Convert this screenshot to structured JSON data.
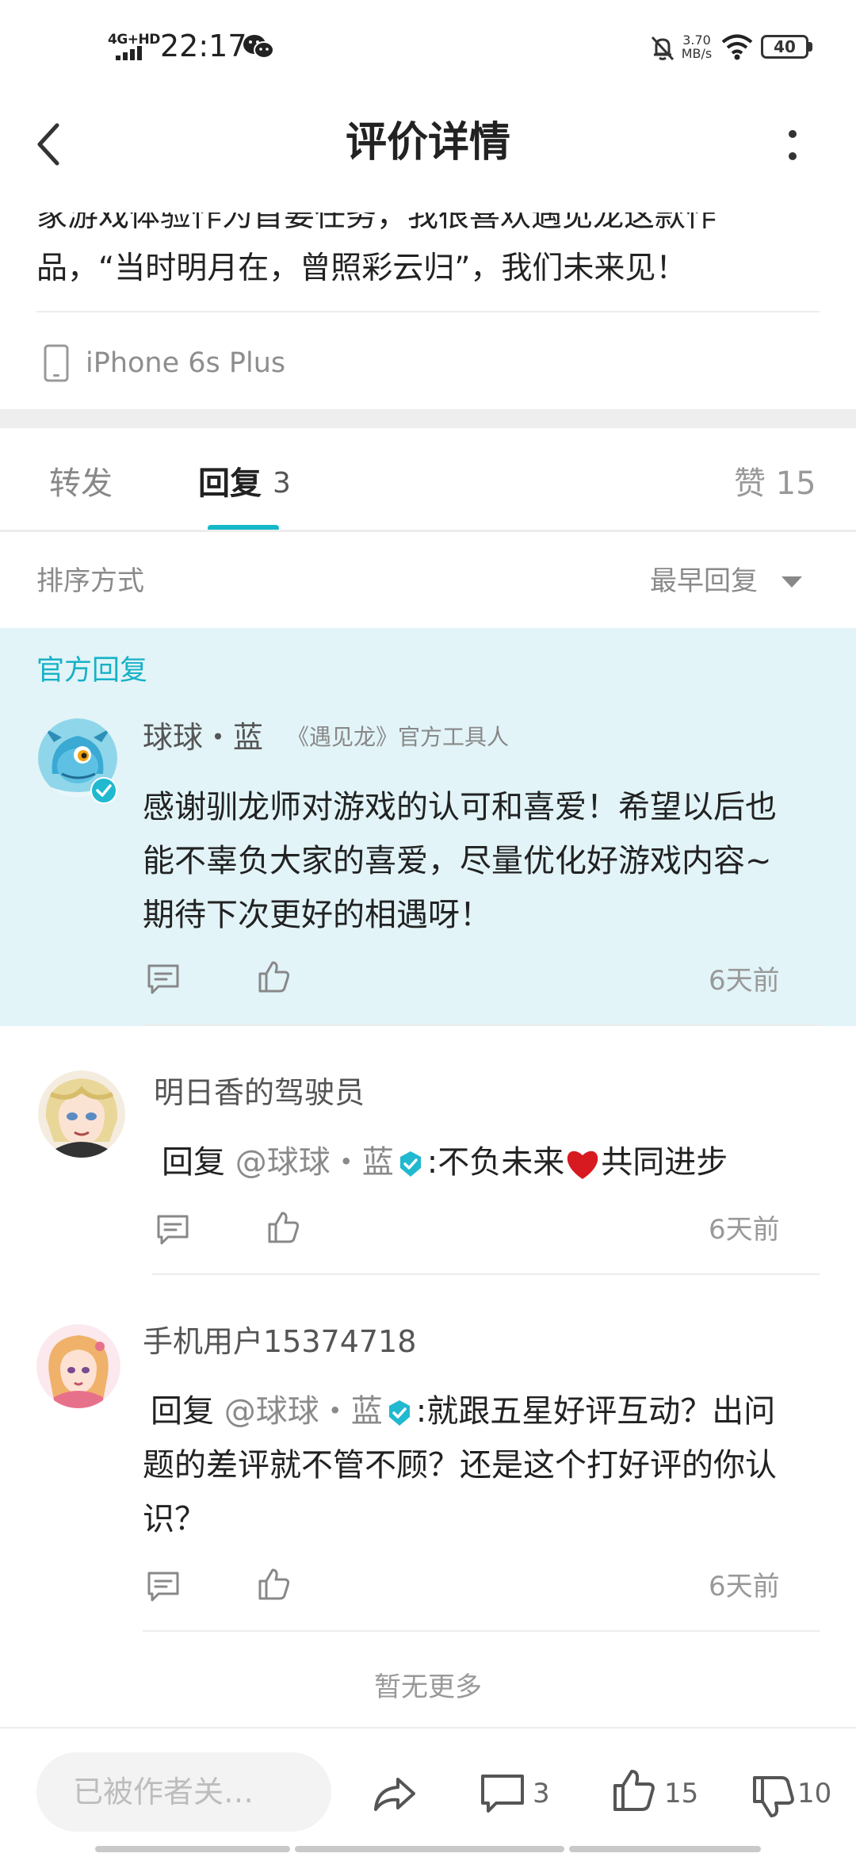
{
  "status_bar": {
    "network": "4G+HD",
    "time": "22:17",
    "speed": "3.70",
    "speed_unit": "MB/s",
    "battery": "40"
  },
  "header": {
    "title": "评价详情"
  },
  "review": {
    "text_line1": "家游戏体验作为首要任务，我很喜欢遇见龙这款作",
    "text_line2": "品，“当时明月在，曾照彩云归”，我们未来见！",
    "device": "iPhone 6s Plus"
  },
  "tabs": {
    "repost": "转发",
    "reply": "回复",
    "reply_count": "3",
    "like": "赞 15"
  },
  "sort": {
    "label": "排序方式",
    "value": "最早回复"
  },
  "official": {
    "section_label": "官方回复",
    "author": "球球・蓝",
    "author_tag": "《遇见龙》官方工具人",
    "text_line1": "感谢驯龙师对游戏的认可和喜爱！希望以后也",
    "text_line2": "能不辜负大家的喜爱，尽量优化好游戏内容~",
    "text_line3": "期待下次更好的相遇呀！",
    "time": "6天前"
  },
  "replies": [
    {
      "author": "明日香的驾驶员",
      "prefix": "回复",
      "mention": "@球球・蓝",
      "text_before_heart": ":不负未来",
      "text_after_heart": "共同进步",
      "time": "6天前"
    },
    {
      "author": "手机用户15374718",
      "prefix": "回复",
      "mention": "@球球・蓝",
      "text_line1": ":就跟五星好评互动？出问",
      "text_line2": "题的差评就不管不顾？还是这个打好评的你认",
      "text_line3": "识？",
      "time": "6天前"
    }
  ],
  "footer_end": "暂无更多",
  "bottom_bar": {
    "input_placeholder": "已被作者关…",
    "comment_count": "3",
    "like_count": "15",
    "dislike_count": "10"
  },
  "colors": {
    "accent": "#14b9c8",
    "official_bg": "#e2f4f8"
  }
}
